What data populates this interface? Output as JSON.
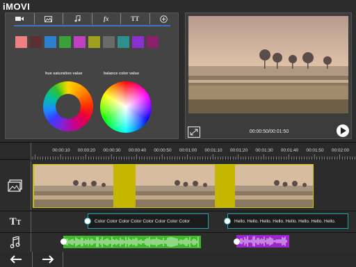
{
  "app": {
    "title": "iMOVI"
  },
  "editor": {
    "tabs": [
      {
        "icon": "video-camera-icon",
        "label": ""
      },
      {
        "icon": "image-icon",
        "label": ""
      },
      {
        "icon": "music-note-icon",
        "label": ""
      },
      {
        "icon": "effects-icon",
        "label": "fx"
      },
      {
        "icon": "text-icon",
        "label": "TT"
      },
      {
        "icon": "add-circle-icon",
        "label": ""
      }
    ],
    "active_tab_color": "#3b74c4",
    "swatches": [
      "#f08080",
      "#5c3030",
      "#2f7fd0",
      "#3aa03a",
      "#c040c0",
      "#a0a020",
      "#6a6a6a",
      "#2f8f8f",
      "#8a2fd0",
      "#8a1f6a"
    ],
    "hue_label": "hue saturation value",
    "balance_label": "balance color value"
  },
  "preview": {
    "time": "00:00:50/00:01:50",
    "expand_icon": "expand-icon",
    "play_icon": "play-icon"
  },
  "timeline": {
    "ticks": [
      "00:00:10",
      "00:00:20",
      "00:00:30",
      "00:00:40",
      "00:00:50",
      "00:01:00",
      "00:01:10",
      "00:01:20",
      "00:01:30",
      "00:01:40",
      "00:01:50",
      "00:02:00"
    ],
    "tracks": {
      "video_icon": "image-icon",
      "text_icon": "text-icon",
      "audio_icon": "music-note-icon"
    },
    "text_clips": [
      {
        "word": "Color",
        "repeat": 8,
        "color": "#23a5b5"
      },
      {
        "word": "Hello.",
        "repeat": 8,
        "color": "#23a5b5"
      }
    ],
    "audio_clips": [
      {
        "color": "#3fb82a"
      },
      {
        "color": "#9a28c8"
      }
    ],
    "transition_color": "#c5b600"
  },
  "nav": {
    "back_icon": "arrow-left-icon",
    "forward_icon": "arrow-right-icon"
  }
}
